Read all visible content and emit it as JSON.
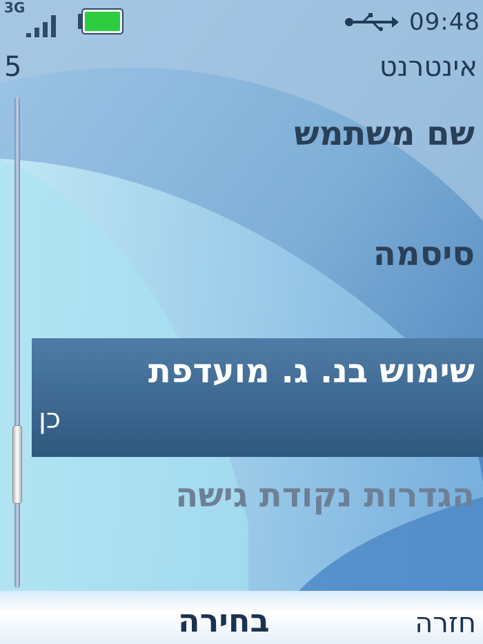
{
  "status_bar": {
    "network_type": "3G",
    "signal_bars": 4,
    "battery_level": 1.0,
    "time": "09:48"
  },
  "header": {
    "level_indicator": "5",
    "title": "אינטרנט"
  },
  "menu": {
    "items": [
      {
        "label": "שם משתמש"
      },
      {
        "label": "סיסמה"
      },
      {
        "label": "שימוש בנ. ג. מועדפת",
        "value": "כן"
      },
      {
        "label": "הגדרות נקודת גישה"
      }
    ],
    "selected_index": 2
  },
  "softkeys": {
    "center": "בחירה",
    "right": "חזרה"
  },
  "colors": {
    "selection": "#3f6a92",
    "text_dark": "#223a55",
    "battery_green": "#2ecc40"
  }
}
